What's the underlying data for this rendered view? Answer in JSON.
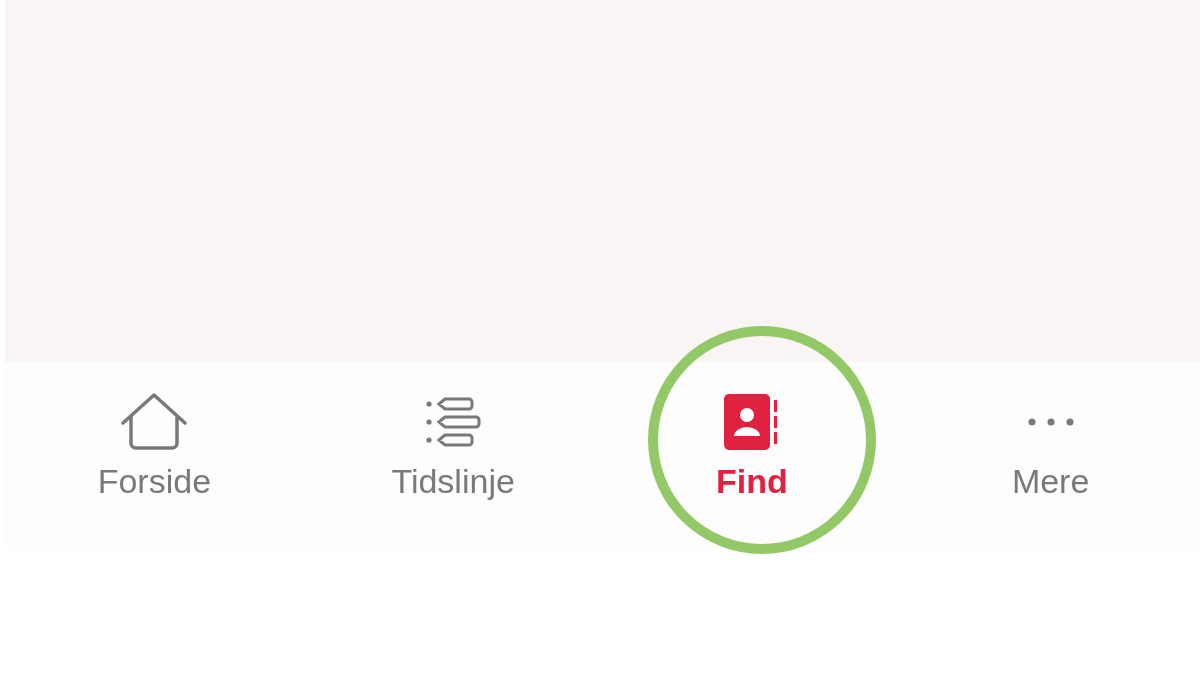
{
  "tab_bar": {
    "tabs": [
      {
        "label": "Forside",
        "kind": "home",
        "selected": false,
        "highlighted": false
      },
      {
        "label": "Tidslinje",
        "kind": "timeline",
        "selected": false,
        "highlighted": false
      },
      {
        "label": "Find",
        "kind": "contacts",
        "selected": true,
        "highlighted": true
      },
      {
        "label": "Mere",
        "kind": "more",
        "selected": false,
        "highlighted": false
      }
    ]
  }
}
